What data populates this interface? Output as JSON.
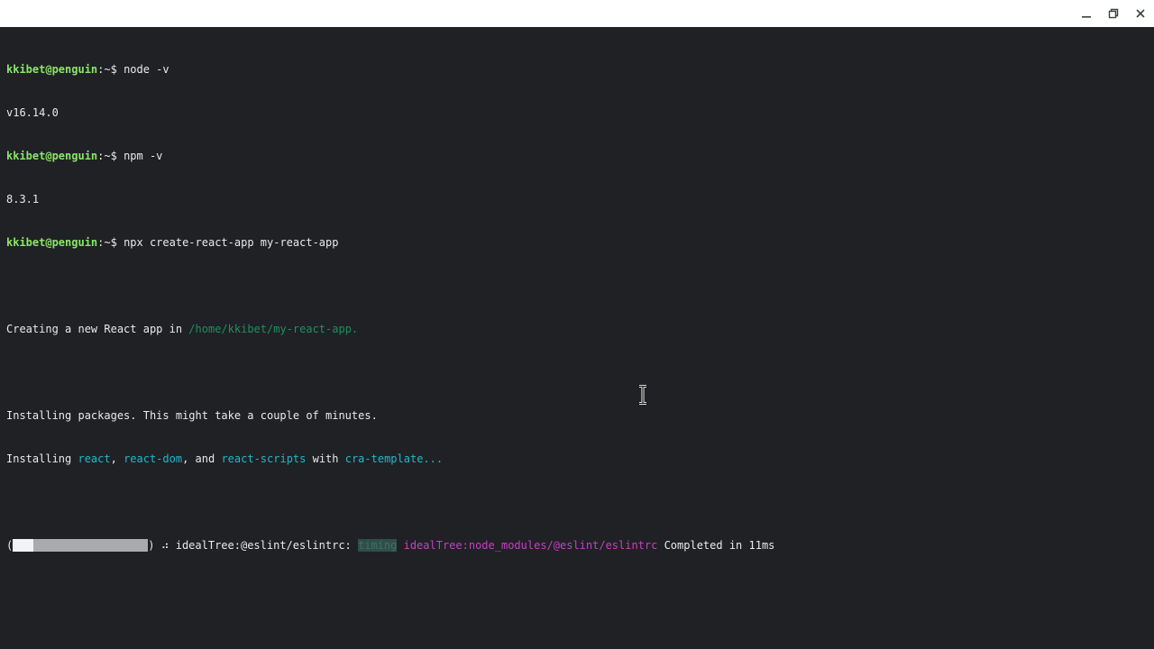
{
  "window": {
    "controls": [
      {
        "name": "minimize-button",
        "icon": "minimize-icon"
      },
      {
        "name": "maximize-button",
        "icon": "restore-icon"
      },
      {
        "name": "close-button",
        "icon": "close-icon"
      }
    ]
  },
  "colors": {
    "background": "#202124",
    "prompt": "#8ae66a",
    "path": "#1e8f63",
    "cyan": "#22b8cc",
    "magenta": "#c540c5"
  },
  "terminal": {
    "prompt_user": "kkibet@penguin",
    "prompt_suffix": ":~$ ",
    "cmd1": "node -v",
    "out1": "v16.14.0",
    "cmd2": "npm -v",
    "out2": "8.3.1",
    "cmd3": "npx create-react-app my-react-app",
    "creating_prefix": "Creating a new React app in ",
    "creating_path": "/home/kkibet/my-react-app",
    "creating_suffix": ".",
    "installing1": "Installing packages. This might take a couple of minutes.",
    "installing2_prefix": "Installing ",
    "pkg_react": "react",
    "sep_comma": ", ",
    "pkg_react_dom": "react-dom",
    "sep_and": ", and ",
    "pkg_react_scripts": "react-scripts",
    "sep_with": " with ",
    "pkg_template": "cra-template",
    "ellipsis": "...",
    "progress": {
      "fraction": 0.15,
      "open": "(",
      "close": ")",
      "spinner": " ⠴ ",
      "stage": "idealTree:@eslint/eslintrc: ",
      "badge": "timing",
      "detail": " idealTree:node_modules/@eslint/eslintrc",
      "completed": " Completed in 11ms"
    }
  }
}
